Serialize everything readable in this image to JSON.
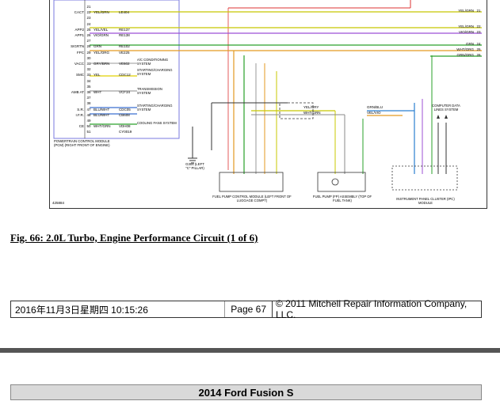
{
  "diagram": {
    "left_connectors": [
      {
        "label": "",
        "pin": "21",
        "wire": "",
        "circuit": ""
      },
      {
        "label": "CACT",
        "pin": "22",
        "wire": "YEL/GRN",
        "circuit": "LE404"
      },
      {
        "label": "",
        "pin": "23",
        "wire": "",
        "circuit": ""
      },
      {
        "label": "",
        "pin": "24",
        "wire": "",
        "circuit": ""
      },
      {
        "label": "APP2",
        "pin": "25",
        "wire": "YEL/VEL",
        "circuit": "RE137"
      },
      {
        "label": "APP1",
        "pin": "26",
        "wire": "VIO/GRN",
        "circuit": "RE138"
      },
      {
        "label": "",
        "pin": "27",
        "wire": "",
        "circuit": ""
      },
      {
        "label": "SIGRTN",
        "pin": "28",
        "wire": "GRN",
        "circuit": "RE102"
      },
      {
        "label": "FPC",
        "pin": "29",
        "wire": "YEL/ORG",
        "circuit": "VE225"
      },
      {
        "label": "",
        "pin": "30",
        "wire": "",
        "circuit": ""
      },
      {
        "label": "VACC",
        "pin": "31",
        "wire": "GRY/BRN",
        "circuit": "VE602"
      },
      {
        "label": "",
        "pin": "32",
        "wire": "",
        "circuit": ""
      },
      {
        "label": "SMC",
        "pin": "33",
        "wire": "YEL",
        "circuit": "CDC12"
      },
      {
        "label": "",
        "pin": "34",
        "wire": "",
        "circuit": ""
      },
      {
        "label": "",
        "pin": "35",
        "wire": "",
        "circuit": ""
      },
      {
        "label": "AMB AT",
        "pin": "36",
        "wire": "WHT",
        "circuit": "VCF34"
      },
      {
        "label": "",
        "pin": "37",
        "wire": "",
        "circuit": ""
      },
      {
        "label": "",
        "pin": "38",
        "wire": "",
        "circuit": ""
      },
      {
        "label": "S.R.",
        "pin": "47",
        "wire": "BLU/WHT",
        "circuit": "CDC05"
      },
      {
        "label": "I.F.R.",
        "pin": "48",
        "wire": "BLU/WHT",
        "circuit": "CB608"
      },
      {
        "label": "",
        "pin": "49",
        "wire": "",
        "circuit": ""
      },
      {
        "label": "CE",
        "pin": "50",
        "wire": "WHT/GRN",
        "circuit": "VDH08"
      },
      {
        "label": "",
        "pin": "51",
        "wire": "",
        "circuit": "CY0019"
      }
    ],
    "right_connectors": [
      {
        "wire": "YEL/GRN",
        "pin": "21"
      },
      {
        "wire": "YEL/GRN",
        "pin": "22"
      },
      {
        "wire": "VIO/GRN",
        "pin": "23"
      },
      {
        "wire": "GRN",
        "pin": "24"
      },
      {
        "wire": "WHT/ORG",
        "pin": "25"
      },
      {
        "wire": "GRN/ORG",
        "pin": "26"
      }
    ],
    "destinations": [
      "A/C CONDITIONING SYSTEM",
      "STARTING/CHARGING SYSTEM",
      "TRANSMISSION SYSTEM",
      "STARTING/CHARGING SYSTEM",
      "COOLING FANS SYSTEM"
    ],
    "pcm_label": "POWERTRAIN CONTROL MODULE (PCM) (RIGHT FRONT OF ENGINE)",
    "ground_label": "G304 (LEFT \"C\" PILLAR)",
    "fpcm_label": "FUEL PUMP CONTROL MODULE (LEFT FRONT OF LUGGAGE COMPT)",
    "fp_label": "FUEL PUMP (FP) ASSEMBLY (TOP OF FUEL TANK)",
    "ipc_label": "INSTRUMENT PANEL CLUSTER (IPC) MODULE",
    "computer_label": "COMPUTER DATA LINES SYSTEM",
    "mid_wire_1": "YEL/GRY",
    "mid_wire_2": "WHT/GRN",
    "mid_wire_3": "GRN/BLU",
    "mid_wire_4": "VEL/VIO",
    "fig_id": "425884"
  },
  "caption": "Fig. 66: 2.0L Turbo, Engine Performance Circuit (1 of 6)",
  "footer": {
    "date": "2016年11月3日星期四  10:15:26",
    "page": "Page 67",
    "copyright": "© 2011 Mitchell Repair Information Company, LLC."
  },
  "next_page": {
    "title": "2014 Ford Fusion S"
  }
}
